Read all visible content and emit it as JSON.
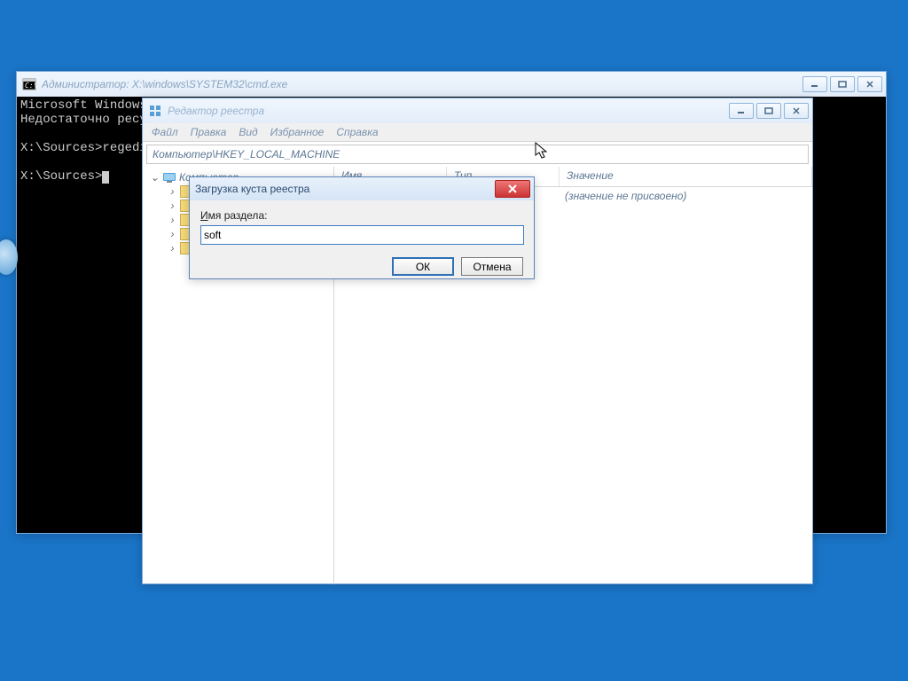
{
  "cmd": {
    "title": "Администратор: X:\\windows\\SYSTEM32\\cmd.exe",
    "line1": "Microsoft Windows",
    "line2": "Недостаточно ресу",
    "line3": "X:\\Sources>regedi",
    "line4": "X:\\Sources>"
  },
  "reg": {
    "title": "Редактор реестра",
    "menu": {
      "file": "Файл",
      "edit": "Правка",
      "view": "Вид",
      "fav": "Избранное",
      "help": "Справка"
    },
    "address": "Компьютер\\HKEY_LOCAL_MACHINE",
    "tree_root": "Компьютер",
    "cols": {
      "name": "Имя",
      "type": "Тип",
      "value": "Значение"
    },
    "default_value": "(значение не присвоено)"
  },
  "dlg": {
    "title": "Загрузка куста реестра",
    "label_prefix": "И",
    "label_rest": "мя раздела:",
    "value": "soft",
    "ok": "ОК",
    "cancel": "Отмена"
  }
}
